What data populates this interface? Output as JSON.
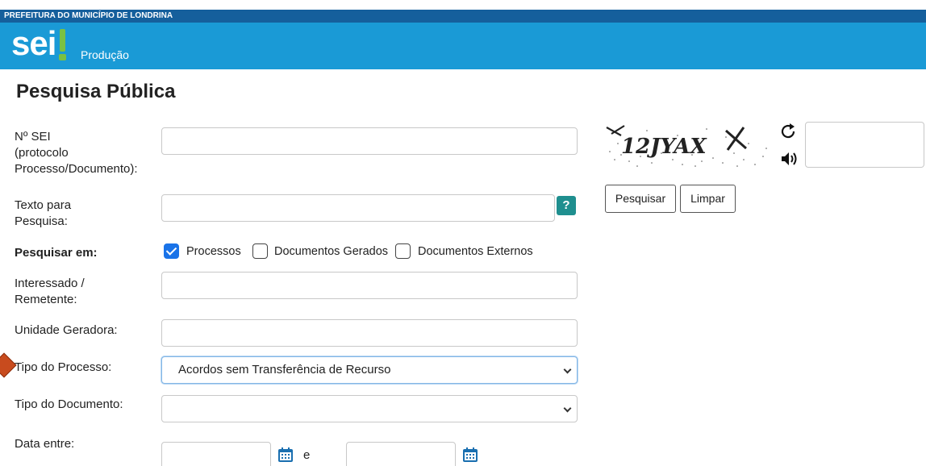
{
  "header": {
    "org": "PREFEITURA DO MUNICÍPIO DE LONDRINA",
    "logo_text": "sei",
    "environment": "Produção"
  },
  "page": {
    "title": "Pesquisa Pública"
  },
  "form": {
    "sei_number": {
      "label_1": "Nº SEI",
      "label_2": "(protocolo",
      "label_3": "Processo/Documento):",
      "value": ""
    },
    "search_text": {
      "label_1": "Texto para",
      "label_2": "Pesquisa:",
      "value": "",
      "help": "?"
    },
    "search_in": {
      "label": "Pesquisar em:",
      "options": [
        {
          "label": "Processos",
          "checked": true
        },
        {
          "label": "Documentos Gerados",
          "checked": false
        },
        {
          "label": "Documentos Externos",
          "checked": false
        }
      ]
    },
    "interested": {
      "label_1": "Interessado /",
      "label_2": "Remetente:",
      "value": ""
    },
    "unit": {
      "label": "Unidade Geradora:",
      "value": ""
    },
    "process_type": {
      "label": "Tipo do Processo:",
      "selected": "Acordos sem Transferência de Recurso"
    },
    "doc_type": {
      "label": "Tipo do Documento:",
      "selected": ""
    },
    "date_range": {
      "label": "Data entre:",
      "from": "",
      "separator": "e",
      "to": ""
    }
  },
  "captcha": {
    "code": "12JYAX",
    "input_value": ""
  },
  "actions": {
    "search": "Pesquisar",
    "clear": "Limpar"
  },
  "colors": {
    "topbar": "#155f9c",
    "brandbar": "#1a9ad6",
    "logo_accent": "#7ac143",
    "help": "#1f8f8f",
    "checkbox": "#1a73e8"
  }
}
